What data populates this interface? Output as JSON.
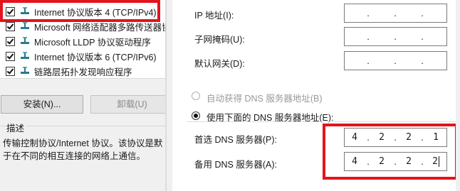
{
  "components": [
    {
      "label": "Internet 协议版本 4 (TCP/IPv4)",
      "checked": true
    },
    {
      "label": "Microsoft 网络适配器多路传送器协",
      "checked": true
    },
    {
      "label": "Microsoft LLDP 协议驱动程序",
      "checked": true
    },
    {
      "label": "Internet 协议版本 6 (TCP/IPv6)",
      "checked": true
    },
    {
      "label": "链路层拓扑发现响应程序",
      "checked": true
    }
  ],
  "buttons": {
    "install": "安装(N)...",
    "uninstall": "卸载(U)"
  },
  "description": {
    "title": "描述",
    "line1": "传输控制协议/Internet 协议。该协议是默",
    "line2": "于在不同的相互连接的网络上通信。"
  },
  "ip_settings": {
    "ip_label": "IP 地址(I):",
    "mask_label": "子网掩码(U):",
    "gateway_label": "默认网关(D):",
    "empty_dot": "."
  },
  "dns": {
    "auto_label": "自动获得 DNS 服务器地址(B)",
    "manual_label": "使用下面的 DNS 服务器地址(E):",
    "preferred_label": "首选 DNS 服务器(P):",
    "alternate_label": "备用 DNS 服务器(A):",
    "preferred": [
      "4",
      "2",
      "2",
      "1"
    ],
    "alternate": [
      "4",
      "2",
      "2",
      "2"
    ]
  },
  "colors": {
    "highlight_border": "#e3141b"
  }
}
